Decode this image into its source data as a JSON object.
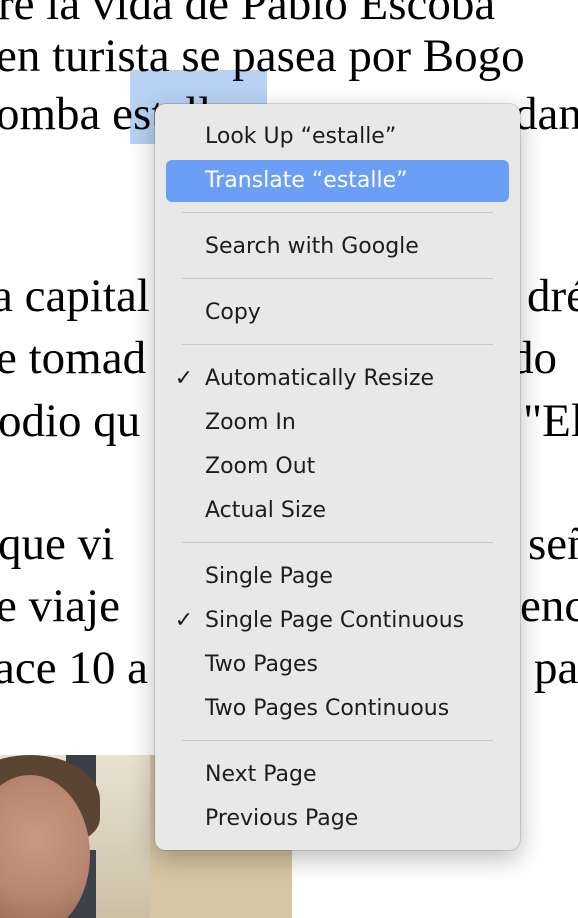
{
  "document": {
    "lines": [
      "re la vida de Pablo Escoba",
      "en turista se pasea por Bogo",
      "omba estalle",
      "dan",
      "a capital",
      "dré",
      "e tomad",
      "do",
      "odio qu",
      "\"El",
      "que vi",
      "señ",
      "e viaje",
      "enc",
      "ace 10 a",
      "pa"
    ]
  },
  "menu": {
    "items": [
      {
        "label": "Look Up “estalle”",
        "checked": false,
        "highlighted": false
      },
      {
        "label": "Translate “estalle”",
        "checked": false,
        "highlighted": true
      },
      {
        "label": "Search with Google",
        "checked": false,
        "highlighted": false
      },
      {
        "label": "Copy",
        "checked": false,
        "highlighted": false
      },
      {
        "label": "Automatically Resize",
        "checked": true,
        "highlighted": false
      },
      {
        "label": "Zoom In",
        "checked": false,
        "highlighted": false
      },
      {
        "label": "Zoom Out",
        "checked": false,
        "highlighted": false
      },
      {
        "label": "Actual Size",
        "checked": false,
        "highlighted": false
      },
      {
        "label": "Single Page",
        "checked": false,
        "highlighted": false
      },
      {
        "label": "Single Page Continuous",
        "checked": true,
        "highlighted": false
      },
      {
        "label": "Two Pages",
        "checked": false,
        "highlighted": false
      },
      {
        "label": "Two Pages Continuous",
        "checked": false,
        "highlighted": false
      },
      {
        "label": "Next Page",
        "checked": false,
        "highlighted": false
      },
      {
        "label": "Previous Page",
        "checked": false,
        "highlighted": false
      }
    ],
    "check_glyph": "✓",
    "highlight_color": "#6a9ff5",
    "background_color": "#e8e8e8"
  },
  "colors": {
    "selection": "#b7d2f2"
  }
}
